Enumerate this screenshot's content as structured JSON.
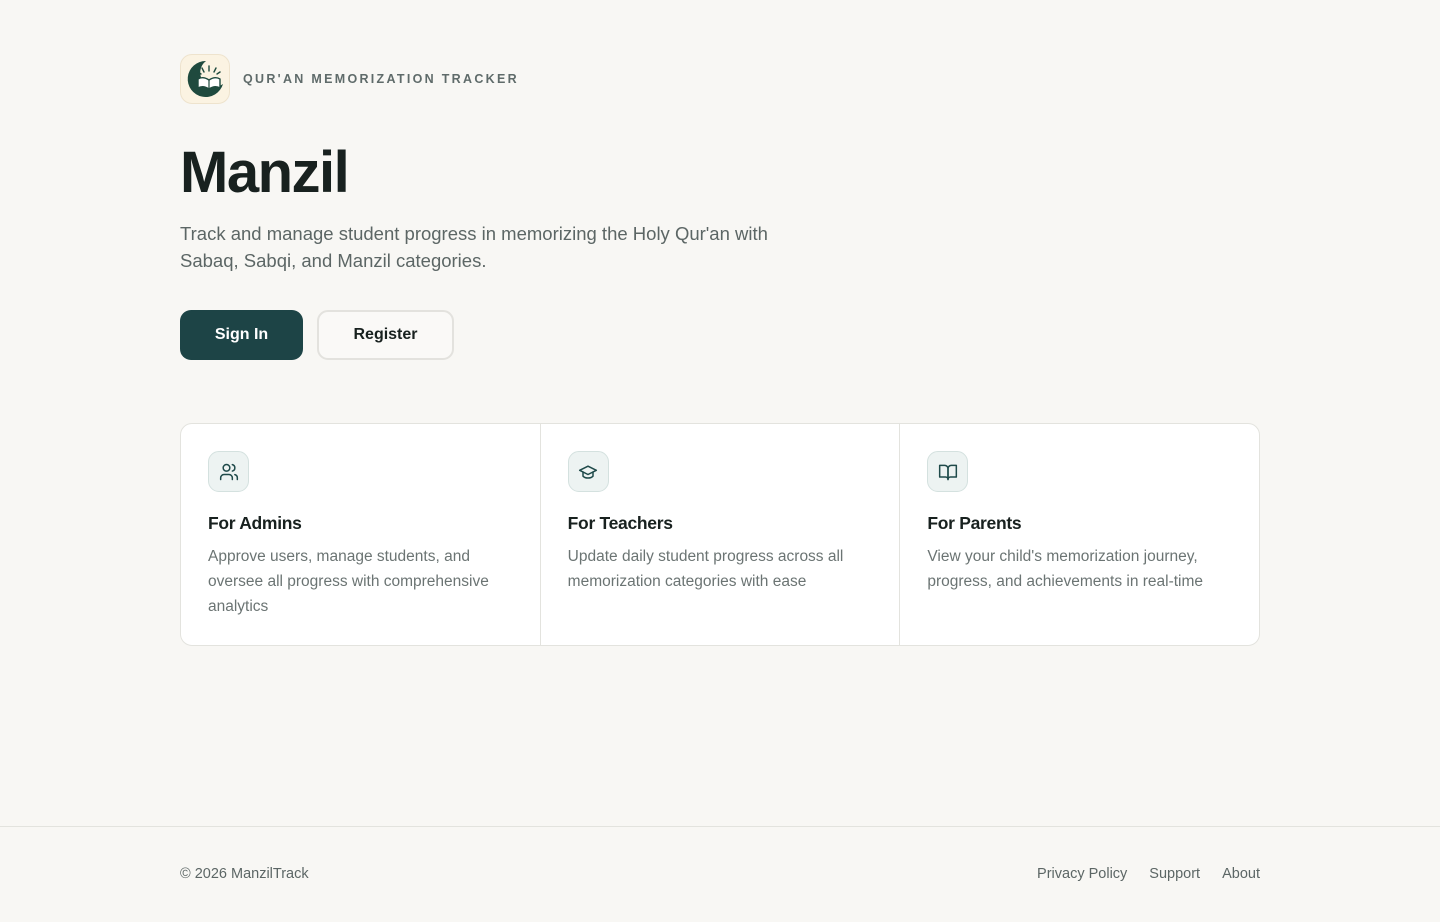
{
  "brand": {
    "logo_icon": "crescent-open-book-icon",
    "tagline": "QUR'AN MEMORIZATION TRACKER"
  },
  "hero": {
    "title": "Manzil",
    "subtitle": "Track and manage student progress in memorizing the Holy Qur'an with Sabaq, Sabqi, and Manzil categories."
  },
  "actions": {
    "sign_in_label": "Sign In",
    "register_label": "Register"
  },
  "features": [
    {
      "icon": "users-icon",
      "title": "For Admins",
      "description": "Approve users, manage students, and oversee all progress with comprehensive analytics"
    },
    {
      "icon": "graduation-cap-icon",
      "title": "For Teachers",
      "description": "Update daily student progress across all memorization categories with ease"
    },
    {
      "icon": "book-open-icon",
      "title": "For Parents",
      "description": "View your child's memorization journey, progress, and achievements in real-time"
    }
  ],
  "footer": {
    "copyright": "© 2026 ManzilTrack",
    "links": [
      "Privacy Policy",
      "Support",
      "About"
    ]
  },
  "colors": {
    "background": "#f8f7f4",
    "primary": "#1d4446",
    "text": "#18211f",
    "muted": "#5c6665",
    "border": "#e3e3de"
  }
}
